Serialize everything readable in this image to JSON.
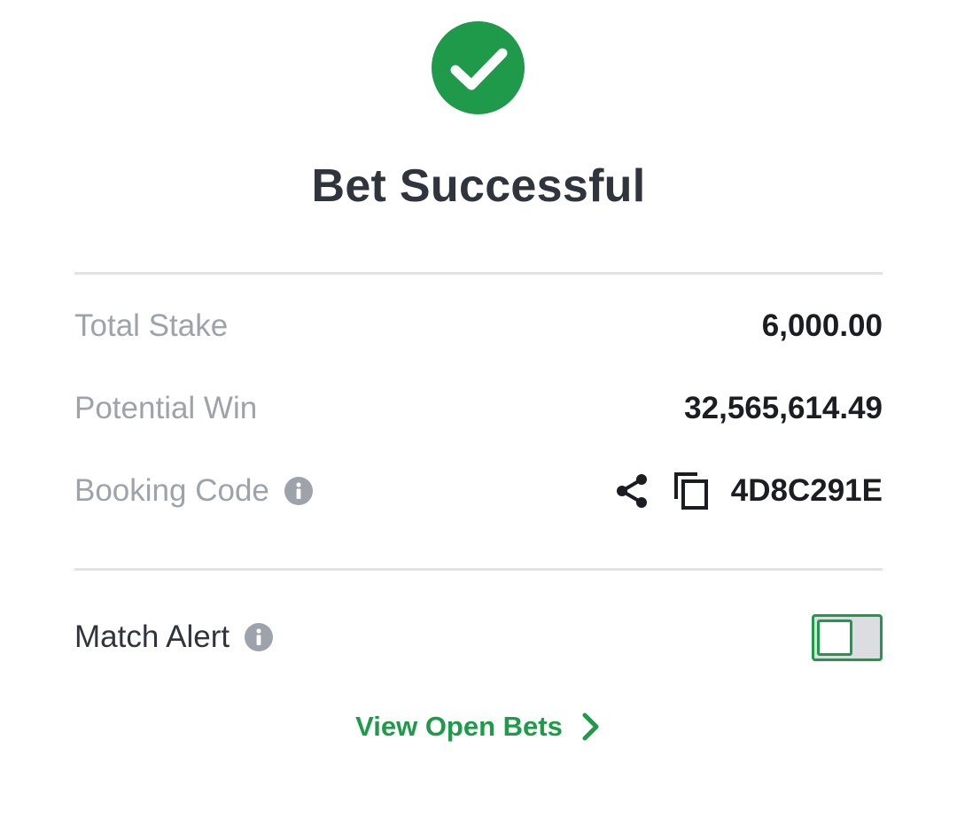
{
  "header": {
    "icon": "check-circle-icon",
    "title": "Bet Successful"
  },
  "summary": {
    "total_stake_label": "Total Stake",
    "total_stake_value": "6,000.00",
    "potential_win_label": "Potential Win",
    "potential_win_value": "32,565,614.49",
    "booking_code_label": "Booking Code",
    "booking_code_value": "4D8C291E"
  },
  "alerts": {
    "match_alert_label": "Match Alert",
    "match_alert_enabled": false
  },
  "footer": {
    "view_open_bets_label": "View Open Bets"
  },
  "colors": {
    "success_green": "#1f9a4a",
    "title_text": "#30343d",
    "muted_label": "#9ea2aa"
  },
  "icons": [
    "check-circle-icon",
    "info-icon",
    "share-icon",
    "copy-icon",
    "chevron-right-icon"
  ]
}
